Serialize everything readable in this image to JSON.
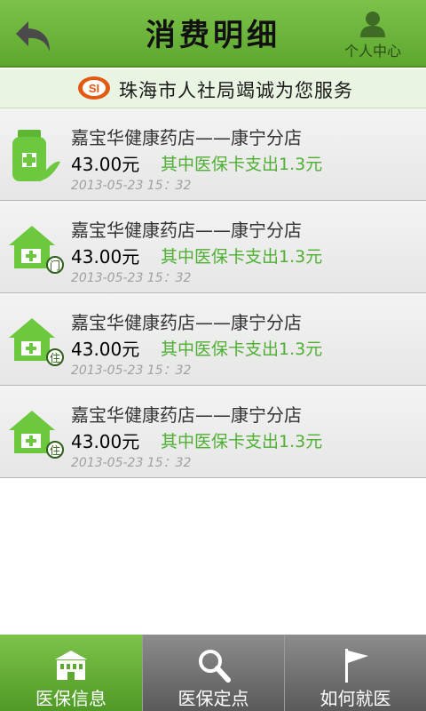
{
  "header": {
    "title": "消费明细",
    "profile_label": "个人中心"
  },
  "banner": {
    "logo_text": "SI",
    "text": "珠海市人社局竭诚为您服务"
  },
  "records": [
    {
      "icon": "medicine-bottle-icon",
      "badge": "",
      "name": "嘉宝华健康药店——康宁分店",
      "amount": "43.00元",
      "note": "其中医保卡支出1.3元",
      "time": "2013-05-23 15：32"
    },
    {
      "icon": "clinic-house-icon",
      "badge": "门",
      "name": "嘉宝华健康药店——康宁分店",
      "amount": "43.00元",
      "note": "其中医保卡支出1.3元",
      "time": "2013-05-23 15：32"
    },
    {
      "icon": "clinic-house-icon",
      "badge": "住",
      "name": "嘉宝华健康药店——康宁分店",
      "amount": "43.00元",
      "note": "其中医保卡支出1.3元",
      "time": "2013-05-23 15：32"
    },
    {
      "icon": "clinic-house-icon",
      "badge": "住",
      "name": "嘉宝华健康药店——康宁分店",
      "amount": "43.00元",
      "note": "其中医保卡支出1.3元",
      "time": "2013-05-23 15：32"
    }
  ],
  "tabs": [
    {
      "label": "医保信息",
      "icon": "building-icon",
      "active": true
    },
    {
      "label": "医保定点",
      "icon": "search-icon",
      "active": false
    },
    {
      "label": "如何就医",
      "icon": "flag-icon",
      "active": false
    }
  ],
  "colors": {
    "brand_green": "#5ea82f",
    "note_green": "#4faf33"
  }
}
